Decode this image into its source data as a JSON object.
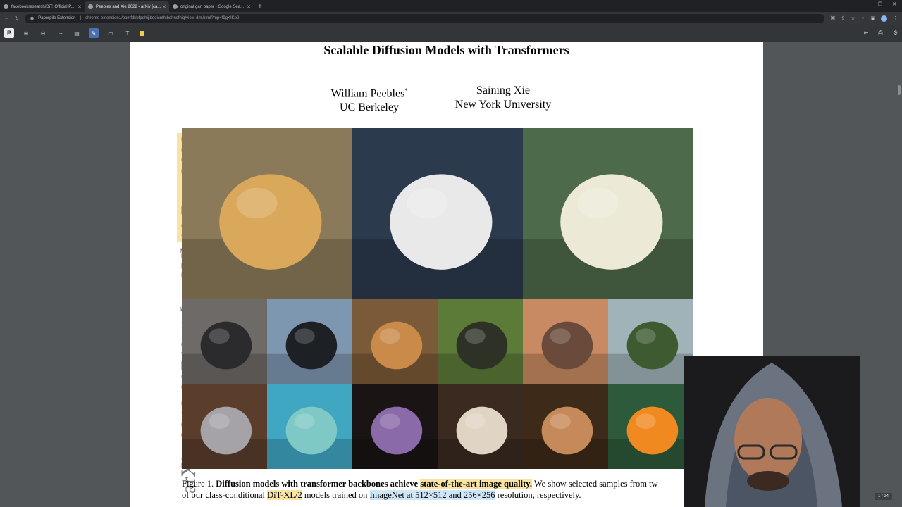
{
  "browser": {
    "tabs": [
      {
        "label": "facebookresearch/DiT: Official P..."
      },
      {
        "label": "Peebles and Xie 2022 - arXiv [ca..."
      },
      {
        "label": "original gan paper - Google Sea..."
      }
    ],
    "address": {
      "extension_label": "Paperpile Extension",
      "url": "chrome-extension://bomfdkbfpdhijjbeoicnfhjbdhncfhig/view-dm.html?mp=f9gKIKb2"
    }
  },
  "paper": {
    "title": "Scalable Diffusion Models with Transformers",
    "authors": [
      {
        "name": "William Peebles",
        "mark": "*",
        "affiliation": "UC Berkeley"
      },
      {
        "name": "Saining Xie",
        "mark": "",
        "affiliation": "New York University"
      }
    ],
    "arxiv_id_prefix": "arXiv:2212.09748v1  [cs.CV]  ",
    "arxiv_date": "19 Dec 2022",
    "caption": {
      "label": "Figure 1. ",
      "bold": "Diffusion models with transformer backbones achieve ",
      "highlight1": "state-of-the-art image quality.",
      "text1": " We show selected samples from tw",
      "text2": "of our class-conditional ",
      "highlight2": "DiT-XL/2",
      "text3": " models trained on ",
      "highlight3": "ImageNet at 512×512 and 256×256",
      "text4": " resolution, respectively."
    },
    "images": [
      {
        "name": "golden-retriever-puppy",
        "bg": "#8a7a5a",
        "fg": "#d9a85a"
      },
      {
        "name": "husky",
        "bg": "#2b3a4d",
        "fg": "#e9e9e9"
      },
      {
        "name": "cockatoo",
        "bg": "#4d6a4a",
        "fg": "#ece9d6"
      },
      {
        "name": "porcupine",
        "bg": "#6e6a67",
        "fg": "#2b2b2e"
      },
      {
        "name": "car-side-mirror",
        "bg": "#7d97b0",
        "fg": "#1d2024"
      },
      {
        "name": "bakery-display",
        "bg": "#7a5a38",
        "fg": "#c98a4a"
      },
      {
        "name": "crocodile",
        "bg": "#5c7a38",
        "fg": "#2e3226"
      },
      {
        "name": "dung-beetle",
        "bg": "#c88a62",
        "fg": "#6a4a3a"
      },
      {
        "name": "suspension-bridge",
        "bg": "#9fb3b8",
        "fg": "#3d5a30"
      },
      {
        "name": "koala",
        "bg": "#5a3d2b",
        "fg": "#a5a3a8"
      },
      {
        "name": "sea-turtle",
        "bg": "#3fa7c2",
        "fg": "#7ec8c5"
      },
      {
        "name": "soap-bubble",
        "bg": "#1a1414",
        "fg": "#8a6aa8"
      },
      {
        "name": "ferret",
        "bg": "#3a2a20",
        "fg": "#e0d4c4"
      },
      {
        "name": "snake",
        "bg": "#3d2a18",
        "fg": "#c68a5a"
      },
      {
        "name": "toucan",
        "bg": "#2d5a3a",
        "fg": "#f08a20"
      }
    ],
    "page_indicator": "1 / 24"
  }
}
